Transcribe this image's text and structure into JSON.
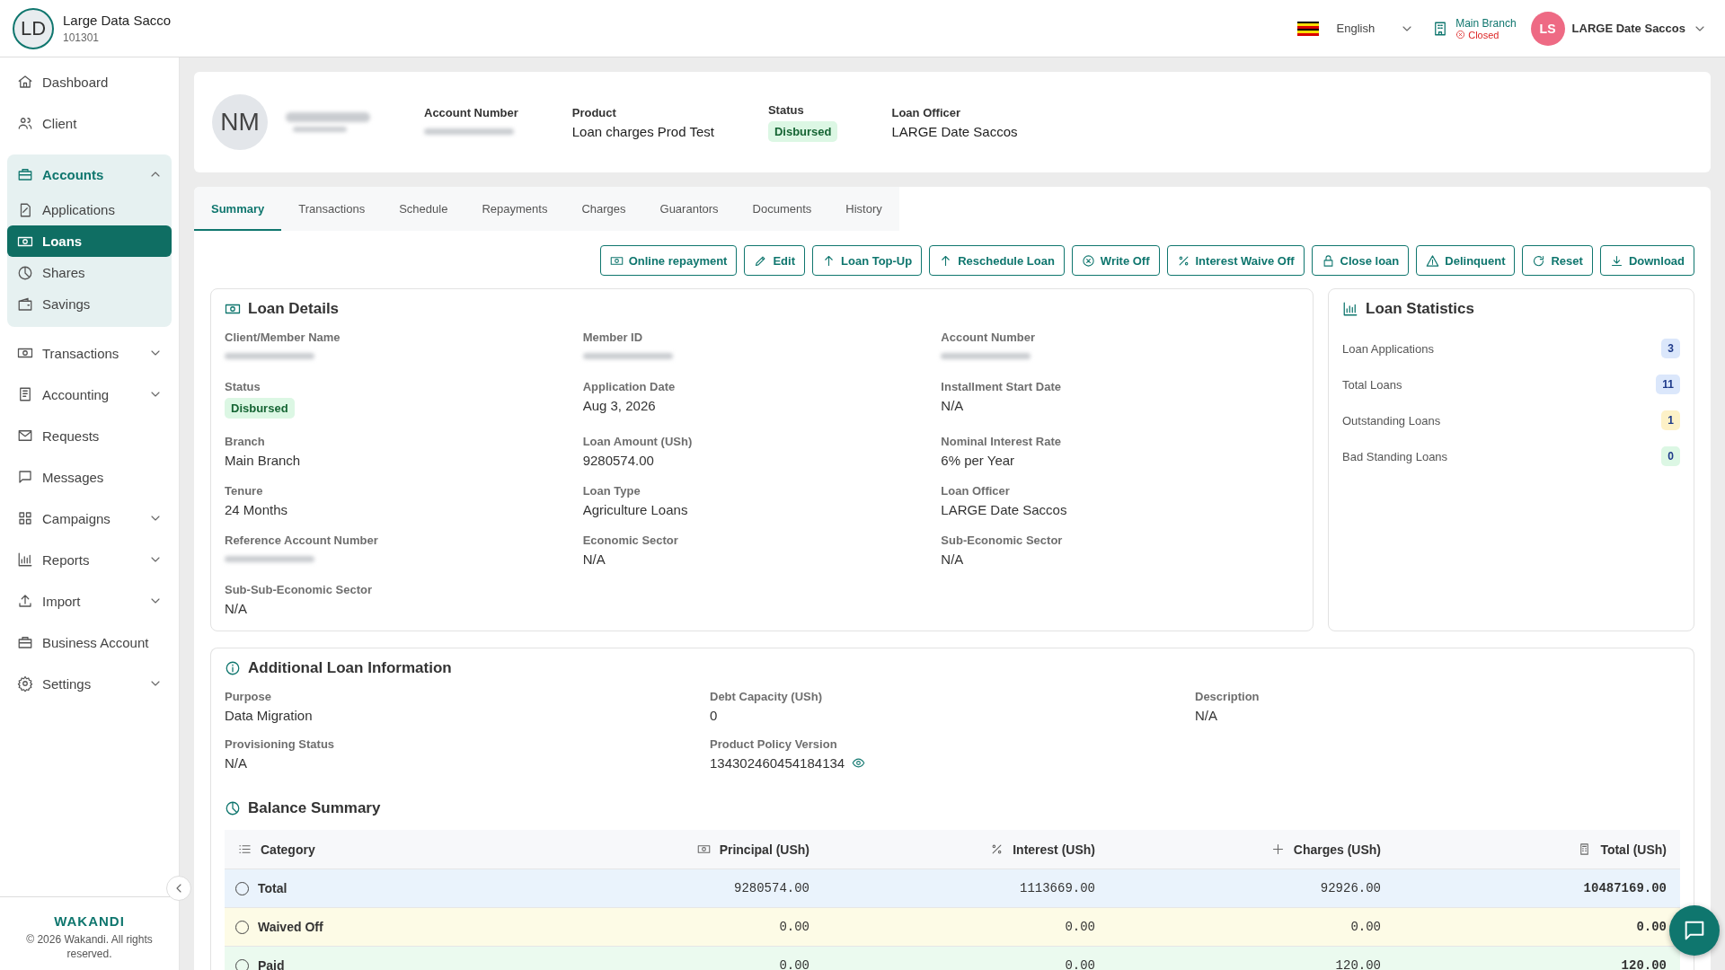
{
  "topbar": {
    "org": {
      "initials": "LD",
      "name": "Large Data Sacco",
      "code": "101301"
    },
    "language": "English",
    "branch": {
      "name": "Main Branch",
      "status": "Closed"
    },
    "user": {
      "initials": "LS",
      "name": "LARGE Date Saccos"
    }
  },
  "sidebar": {
    "items": [
      {
        "label": "Dashboard",
        "kind": "link",
        "selected": false
      },
      {
        "label": "Client",
        "kind": "link",
        "selected": false
      },
      {
        "label": "Accounts",
        "kind": "group",
        "expanded": true,
        "selected": true,
        "children": [
          {
            "label": "Applications",
            "selected": false
          },
          {
            "label": "Loans",
            "selected": true
          },
          {
            "label": "Shares",
            "selected": false
          },
          {
            "label": "Savings",
            "selected": false
          }
        ]
      },
      {
        "label": "Transactions",
        "kind": "group",
        "expanded": false,
        "selected": false
      },
      {
        "label": "Accounting",
        "kind": "group",
        "expanded": false,
        "selected": false
      },
      {
        "label": "Requests",
        "kind": "link",
        "selected": false
      },
      {
        "label": "Messages",
        "kind": "link",
        "selected": false
      },
      {
        "label": "Campaigns",
        "kind": "group",
        "expanded": false,
        "selected": false
      },
      {
        "label": "Reports",
        "kind": "group",
        "expanded": false,
        "selected": false
      },
      {
        "label": "Import",
        "kind": "group",
        "expanded": false,
        "selected": false
      },
      {
        "label": "Business Account",
        "kind": "link",
        "selected": false
      },
      {
        "label": "Settings",
        "kind": "group",
        "expanded": false,
        "selected": false
      }
    ],
    "footer": {
      "brand": "WAKANDI",
      "copyright": "© 2026 Wakandi. All rights reserved."
    }
  },
  "account_header": {
    "initials": "NM",
    "fields": [
      {
        "label": "Account Number",
        "kind": "blurred"
      },
      {
        "label": "Product",
        "value": "Loan charges Prod Test",
        "kind": "text"
      },
      {
        "label": "Status",
        "value": "Disbursed",
        "kind": "badge"
      },
      {
        "label": "Loan Officer",
        "value": "LARGE Date Saccos",
        "kind": "text"
      }
    ]
  },
  "tabs": [
    {
      "label": "Summary",
      "selected": true
    },
    {
      "label": "Transactions",
      "selected": false
    },
    {
      "label": "Schedule",
      "selected": false
    },
    {
      "label": "Repayments",
      "selected": false
    },
    {
      "label": "Charges",
      "selected": false
    },
    {
      "label": "Guarantors",
      "selected": false
    },
    {
      "label": "Documents",
      "selected": false
    },
    {
      "label": "History",
      "selected": false
    }
  ],
  "actions": [
    "Online repayment",
    "Edit",
    "Loan Top-Up",
    "Reschedule Loan",
    "Write Off",
    "Interest Waive Off",
    "Close loan",
    "Delinquent",
    "Reset",
    "Download"
  ],
  "loan_details": {
    "title": "Loan Details",
    "fields": [
      {
        "label": "Client/Member Name",
        "kind": "blurred"
      },
      {
        "label": "Member ID",
        "kind": "blurred"
      },
      {
        "label": "Account Number",
        "kind": "blurred"
      },
      {
        "label": "Status",
        "value": "Disbursed",
        "kind": "badge"
      },
      {
        "label": "Application Date",
        "value": "Aug 3, 2026",
        "kind": "text"
      },
      {
        "label": "Installment Start Date",
        "value": "N/A",
        "kind": "text"
      },
      {
        "label": "Branch",
        "value": "Main Branch",
        "kind": "text"
      },
      {
        "label": "Loan Amount (USh)",
        "value": "9280574.00",
        "kind": "text"
      },
      {
        "label": "Nominal Interest Rate",
        "value": "6% per Year",
        "kind": "text"
      },
      {
        "label": "Tenure",
        "value": "24 Months",
        "kind": "text"
      },
      {
        "label": "Loan Type",
        "value": "Agriculture Loans",
        "kind": "text"
      },
      {
        "label": "Loan Officer",
        "value": "LARGE Date Saccos",
        "kind": "text"
      },
      {
        "label": "Reference Account Number",
        "kind": "blurred"
      },
      {
        "label": "Economic Sector",
        "value": "N/A",
        "kind": "text"
      },
      {
        "label": "Sub-Economic Sector",
        "value": "N/A",
        "kind": "text"
      },
      {
        "label": "Sub-Sub-Economic Sector",
        "value": "N/A",
        "kind": "text"
      }
    ]
  },
  "loan_statistics": {
    "title": "Loan Statistics",
    "items": [
      {
        "label": "Loan Applications",
        "count": "3",
        "color": "#dbe7fb"
      },
      {
        "label": "Total Loans",
        "count": "11",
        "color": "#dbe7fb"
      },
      {
        "label": "Outstanding Loans",
        "count": "1",
        "color": "#fdf1c7"
      },
      {
        "label": "Bad Standing Loans",
        "count": "0",
        "color": "#dcf7e4"
      }
    ]
  },
  "additional_info": {
    "title": "Additional Loan Information",
    "fields": [
      {
        "label": "Purpose",
        "value": "Data Migration",
        "kind": "text"
      },
      {
        "label": "Debt Capacity (USh)",
        "value": "0",
        "kind": "text"
      },
      {
        "label": "Description",
        "value": "N/A",
        "kind": "text"
      },
      {
        "label": "Provisioning Status",
        "value": "N/A",
        "kind": "text"
      },
      {
        "label": "Product Policy Version",
        "value": "134302460454184134",
        "kind": "reveal"
      }
    ]
  },
  "balance_summary": {
    "title": "Balance Summary",
    "columns": [
      "Category",
      "Principal (USh)",
      "Interest (USh)",
      "Charges (USh)",
      "Total (USh)"
    ],
    "rows": [
      {
        "category": "Total",
        "values": [
          "9280574.00",
          "1113669.00",
          "92926.00",
          "10487169.00"
        ],
        "color": "#eaf3fc",
        "selected": false
      },
      {
        "category": "Waived Off",
        "values": [
          "0.00",
          "0.00",
          "0.00",
          "0.00"
        ],
        "color": "#fdfbe6",
        "selected": false
      },
      {
        "category": "Paid",
        "values": [
          "0.00",
          "0.00",
          "120.00",
          "120.00"
        ],
        "color": "#ebfaef",
        "selected": false
      }
    ]
  }
}
